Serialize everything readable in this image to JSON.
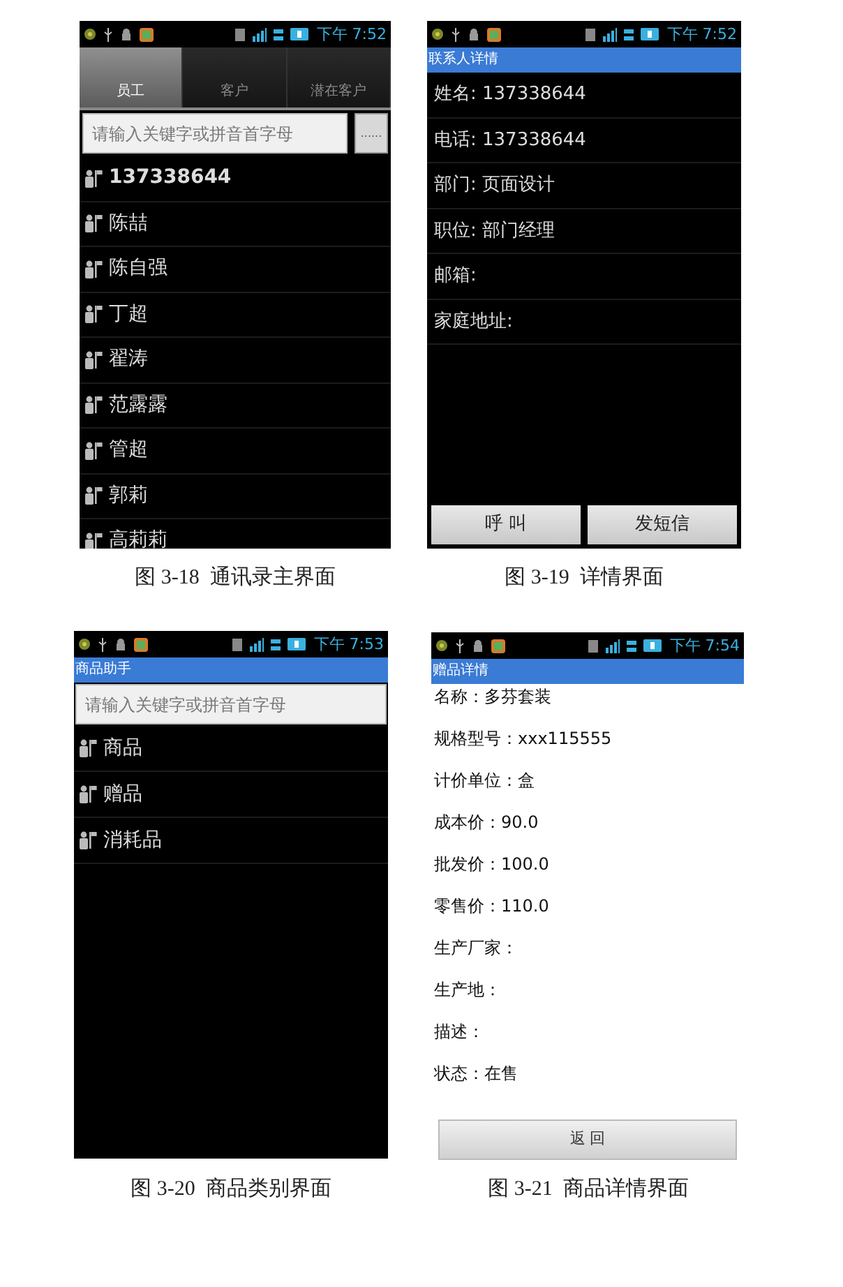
{
  "figures": [
    {
      "kind": "contacts",
      "caption": "图 3-18  通讯录主界面",
      "status_bar": {
        "time": "下午 7:52"
      },
      "tabs": [
        {
          "label": "员工",
          "selected": true
        },
        {
          "label": "客户",
          "selected": false
        },
        {
          "label": "潜在客户",
          "selected": false
        }
      ],
      "search": {
        "placeholder": "请输入关键字或拼音首字母"
      },
      "search_button": "......",
      "items": [
        {
          "label": "137338644",
          "bold": true
        },
        {
          "label": "陈喆",
          "bold": false
        },
        {
          "label": "陈自强",
          "bold": false
        },
        {
          "label": "丁超",
          "bold": false
        },
        {
          "label": "翟涛",
          "bold": false
        },
        {
          "label": "范露露",
          "bold": false
        },
        {
          "label": "管超",
          "bold": false
        },
        {
          "label": "郭莉",
          "bold": false
        },
        {
          "label": "高莉莉",
          "bold": false
        }
      ]
    },
    {
      "kind": "contact_detail",
      "caption": "图 3-19  详情界面",
      "status_bar": {
        "time": "下午 7:52"
      },
      "title": "联系人详情",
      "fields": [
        "姓名: 137338644",
        "电话: 137338644",
        "部门: 页面设计",
        "职位: 部门经理",
        "邮箱:",
        "家庭地址:"
      ],
      "buttons": [
        "呼 叫",
        "发短信"
      ]
    },
    {
      "kind": "categories",
      "caption": "图 3-20  商品类别界面",
      "status_bar": {
        "time": "下午 7:53"
      },
      "title": "商品助手",
      "search": {
        "placeholder": "请输入关键字或拼音首字母"
      },
      "items": [
        {
          "label": "商品",
          "bold": false
        },
        {
          "label": "赠品",
          "bold": false
        },
        {
          "label": "消耗品",
          "bold": false
        }
      ]
    },
    {
      "kind": "product_detail",
      "caption": "图 3-21  商品详情界面",
      "status_bar": {
        "time": "下午 7:54"
      },
      "title": "赠品详情",
      "fields": [
        "名称：多芬套装",
        "规格型号：xxx115555",
        "计价单位：盒",
        "成本价：90.0",
        "批发价：100.0",
        "零售价：110.0",
        "生产厂家：",
        "生产地：",
        "描述：",
        "状态：在售"
      ],
      "buttons": [
        "返 回"
      ]
    }
  ]
}
